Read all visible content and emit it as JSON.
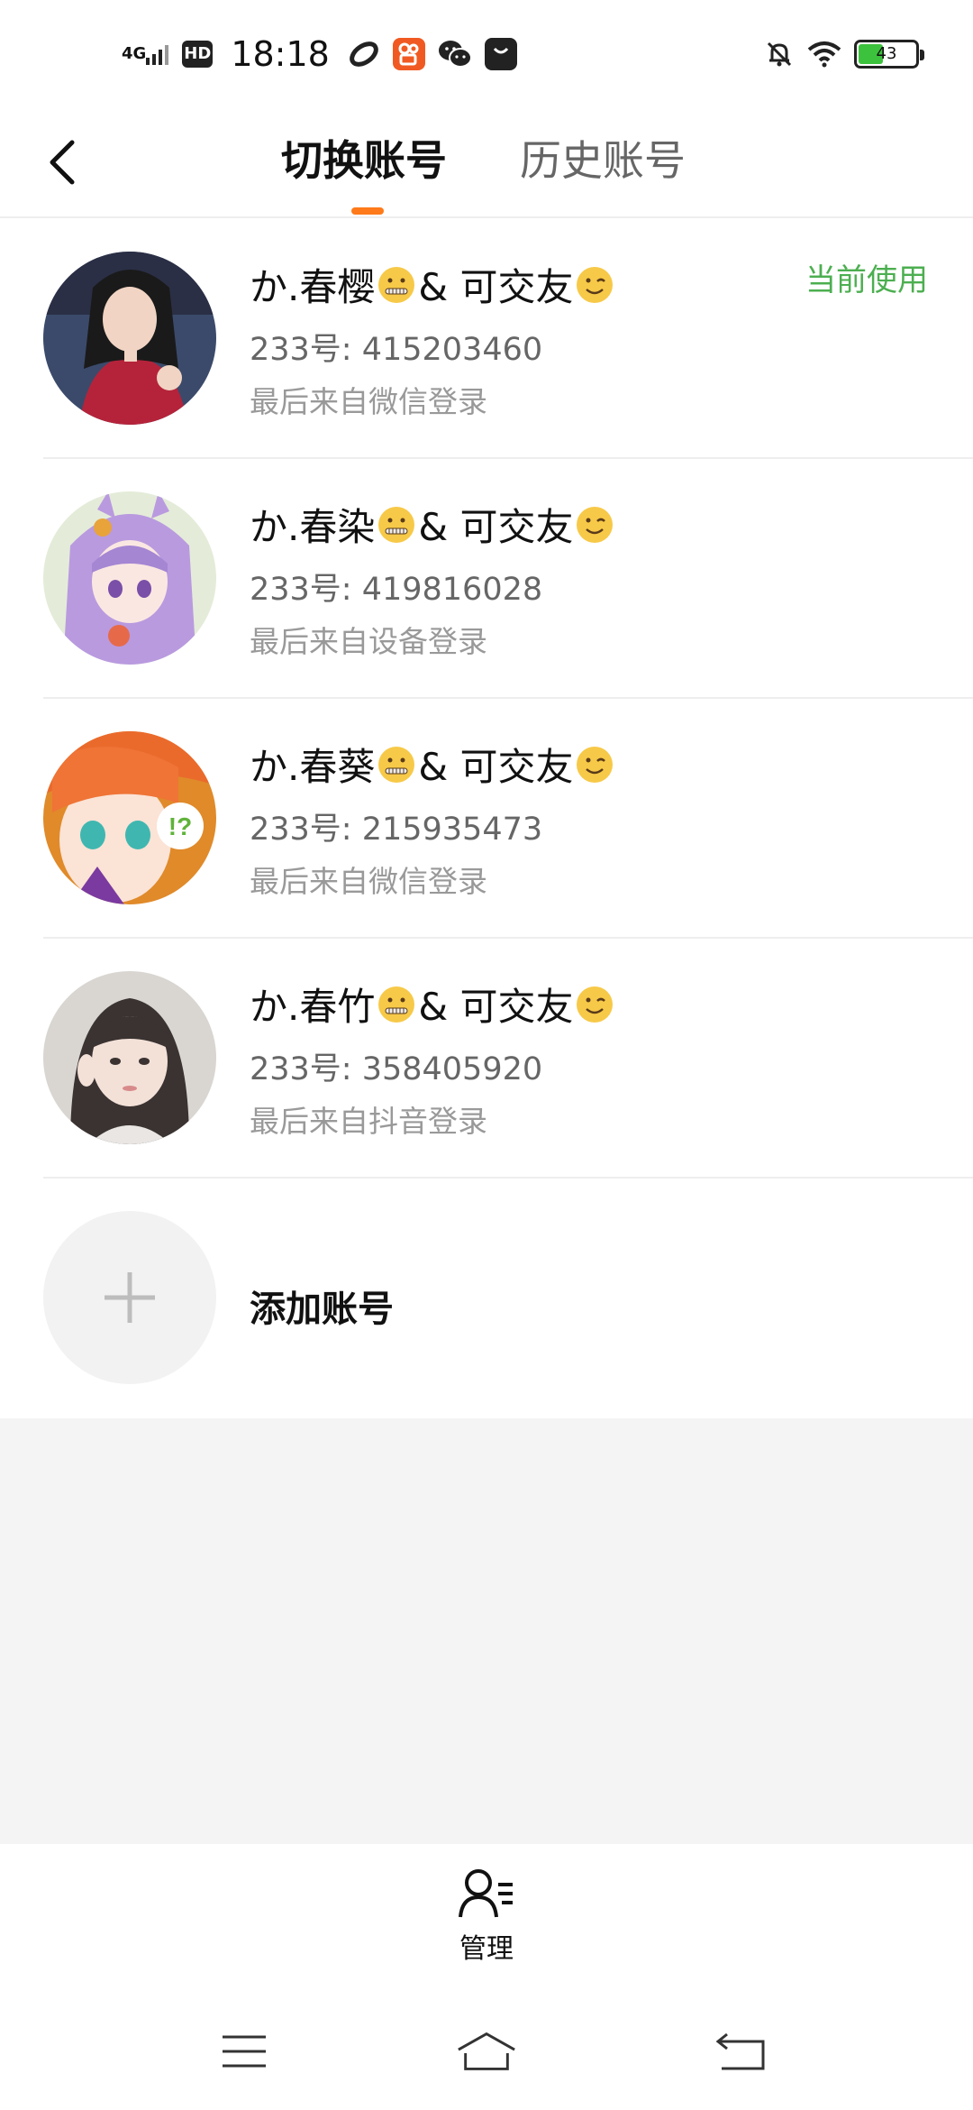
{
  "status_bar": {
    "network": "4G",
    "hd": "HD",
    "time": "18:18",
    "battery": "43",
    "icons": [
      "signal-icon",
      "hd-icon",
      "link-app-icon",
      "kuaishou-app-icon",
      "wechat-icon",
      "shop-bag-icon",
      "mute-bell-icon",
      "wifi-icon",
      "battery-icon"
    ]
  },
  "header": {
    "back_icon": "chevron-left-icon",
    "tabs": [
      {
        "label": "切换账号",
        "active": true
      },
      {
        "label": "历史账号",
        "active": false
      }
    ],
    "accent": "#ff7a1a"
  },
  "accounts": [
    {
      "name_prefix": "か.春樱",
      "name_middle": "& 可交友",
      "emoji_1": "zipper-mouth-face",
      "emoji_2": "winking-face",
      "id_text": "233号: 415203460",
      "source": "最后来自微信登录",
      "current": "当前使用"
    },
    {
      "name_prefix": "か.春染",
      "name_middle": "& 可交友",
      "emoji_1": "zipper-mouth-face",
      "emoji_2": "winking-face",
      "id_text": "233号: 419816028",
      "source": "最后来自设备登录"
    },
    {
      "name_prefix": "か.春葵",
      "name_middle": "& 可交友",
      "emoji_1": "zipper-mouth-face",
      "emoji_2": "winking-face",
      "id_text": "233号: 215935473",
      "source": "最后来自微信登录"
    },
    {
      "name_prefix": "か.春竹",
      "name_middle": "& 可交友",
      "emoji_1": "zipper-mouth-face",
      "emoji_2": "winking-face",
      "id_text": "233号: 358405920",
      "source": "最后来自抖音登录"
    }
  ],
  "add_account": {
    "label": "添加账号",
    "icon": "plus-icon"
  },
  "bottom_bar": {
    "manage_label": "管理",
    "manage_icon": "user-list-icon"
  },
  "nav_bar": {
    "icons": [
      "menu-icon",
      "home-icon",
      "back-icon"
    ]
  },
  "colors": {
    "current_badge": "#4caf50",
    "background_gray": "#f4f4f4"
  }
}
